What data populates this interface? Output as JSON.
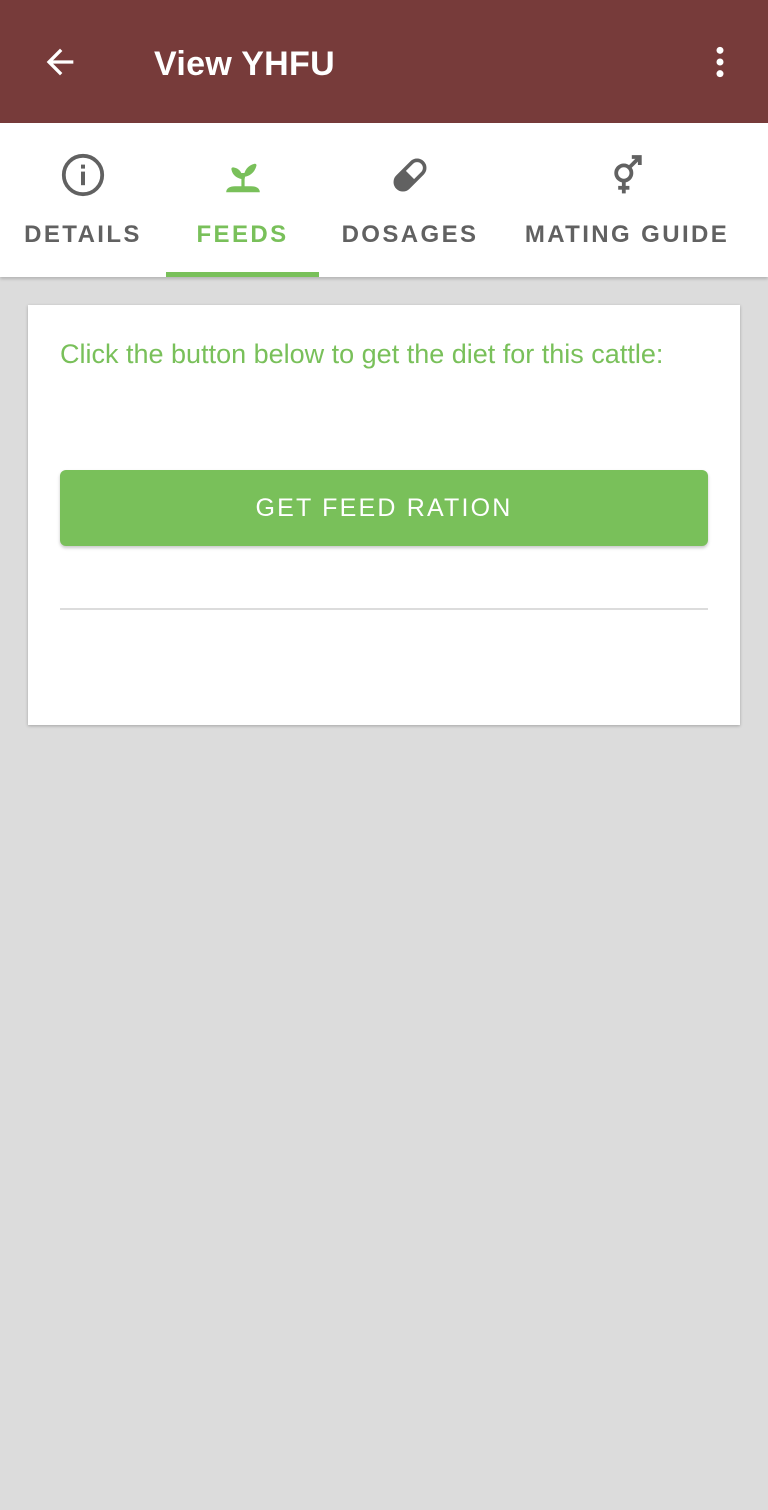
{
  "appbar": {
    "title": "View YHFU",
    "back_icon": "arrow-back-icon",
    "menu_icon": "more-vert-icon",
    "background_color": "#773b3a"
  },
  "tabs": [
    {
      "label": "DETAILS",
      "icon": "info-icon",
      "active": false
    },
    {
      "label": "FEEDS",
      "icon": "sprout-icon",
      "active": true
    },
    {
      "label": "DOSAGES",
      "icon": "pill-icon",
      "active": false
    },
    {
      "label": "MATING GUIDE",
      "icon": "gender-icon",
      "active": false
    }
  ],
  "feeds": {
    "prompt": "Click the button below to get the diet for this cattle:",
    "button_label": "GET FEED RATION"
  },
  "colors": {
    "accent": "#79c05a",
    "tab_text": "#616161",
    "background": "#dcdcdc"
  }
}
